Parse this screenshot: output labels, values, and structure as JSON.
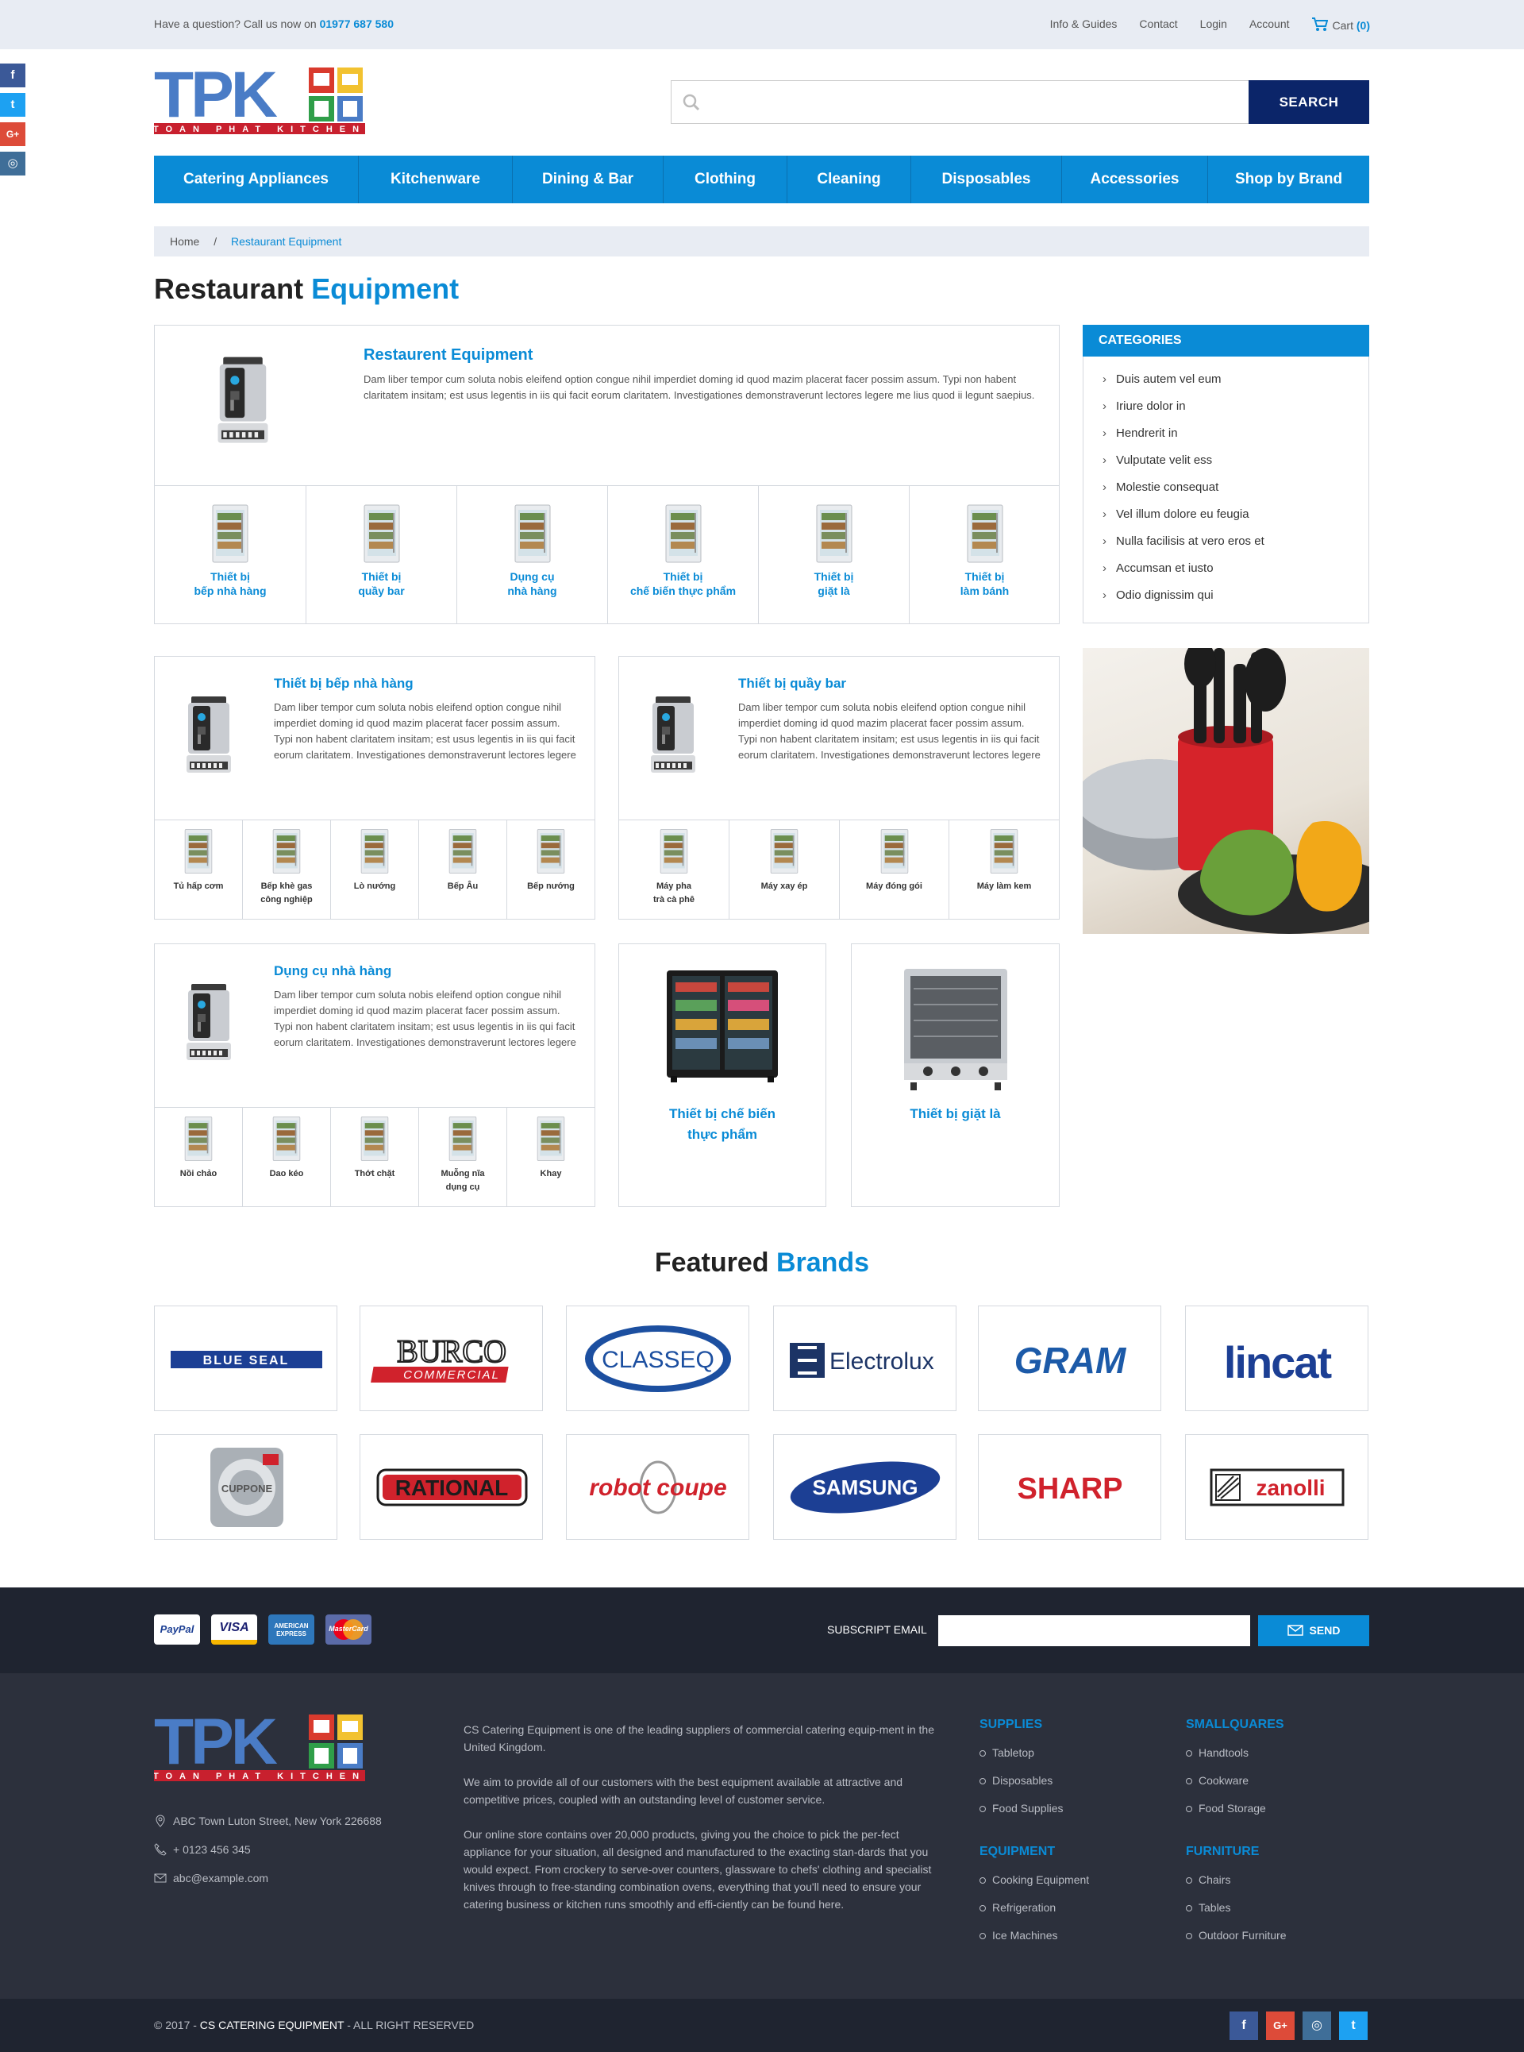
{
  "topbar": {
    "question": "Have a question? Call us now on",
    "phone": "01977 687 580",
    "links": [
      "Info & Guides",
      "Contact",
      "Login",
      "Account"
    ],
    "cart_label": "Cart",
    "cart_count": "(0)"
  },
  "social": [
    {
      "icon": "facebook-icon",
      "glyph": "f",
      "color": "#3b5998"
    },
    {
      "icon": "twitter-icon",
      "glyph": "t",
      "color": "#1da1f2"
    },
    {
      "icon": "google-plus-icon",
      "glyph": "G+",
      "color": "#dd4b39"
    },
    {
      "icon": "instagram-icon",
      "glyph": "◎",
      "color": "#3f6e98"
    }
  ],
  "logo": {
    "text": "TPK",
    "tagline": "TOAN PHAT KITCHEN"
  },
  "search": {
    "button": "SEARCH",
    "placeholder": ""
  },
  "nav": [
    "Catering Appliances",
    "Kitchenware",
    "Dining & Bar",
    "Clothing",
    "Cleaning",
    "Disposables",
    "Accessories",
    "Shop by Brand"
  ],
  "breadcrumb": {
    "home": "Home",
    "sep": "/",
    "current": "Restaurant Equipment"
  },
  "page_title": {
    "a": "Restaurant",
    "b": "Equipment"
  },
  "main": {
    "title": "Restaurent Equipment",
    "desc": "Dam liber tempor cum soluta nobis eleifend option congue nihil imperdiet doming id quod mazim placerat facer possim assum. Typi non habent claritatem insitam; est usus legentis in iis qui facit eorum claritatem. Investigationes demonstraverunt lectores legere me lius quod ii legunt saepius.",
    "subs": [
      "Thiết bị\nbếp nhà hàng",
      "Thiết bị\nquầy bar",
      "Dụng cụ\nnhà hàng",
      "Thiết bị\nchế biến thực phẩm",
      "Thiết bị\ngiặt là",
      "Thiết bị\nlàm bánh"
    ]
  },
  "panel1": {
    "title": "Thiết bị bếp nhà hàng",
    "desc": "Dam liber tempor cum soluta nobis eleifend option congue nihil imperdiet doming id quod mazim placerat facer possim assum. Typi non habent claritatem insitam; est usus legentis in iis qui facit eorum claritatem. Investigationes demonstraverunt lectores legere",
    "subs": [
      "Tủ hấp cơm",
      "Bếp khè gas\ncông nghiệp",
      "Lò nướng",
      "Bếp Âu",
      "Bếp nướng"
    ]
  },
  "panel2": {
    "title": "Thiết bị quầy bar",
    "desc": "Dam liber tempor cum soluta nobis eleifend option congue nihil imperdiet doming id quod mazim placerat facer possim assum. Typi non habent claritatem insitam; est usus legentis in iis qui facit eorum claritatem. Investigationes demonstraverunt lectores legere",
    "subs": [
      "Máy pha\ntrà cà phê",
      "Máy xay ép",
      "Máy đóng gói",
      "Máy làm kem"
    ]
  },
  "panel3": {
    "title": "Dụng cụ nhà hàng",
    "desc": "Dam liber tempor cum soluta nobis eleifend option congue nihil imperdiet doming id quod mazim placerat facer possim assum. Typi non habent claritatem insitam; est usus legentis in iis qui facit eorum claritatem. Investigationes demonstraverunt lectores legere",
    "subs": [
      "Nồi chảo",
      "Dao kéo",
      "Thớt chặt",
      "Muỗng nĩa\ndụng cụ",
      "Khay"
    ]
  },
  "tile1": "Thiết bị chế biến\nthực phẩm",
  "tile2": "Thiết bị giặt là",
  "categories": {
    "title": "CATEGORIES",
    "items": [
      "Duis autem vel eum",
      "Iriure dolor in",
      "Hendrerit in",
      "Vulputate velit ess",
      "Molestie consequat",
      "Vel illum dolore eu feugia",
      "Nulla facilisis at vero eros et",
      "Accumsan et iusto",
      "Odio dignissim qui"
    ]
  },
  "brands_heading": {
    "a": "Featured",
    "b": "Brands"
  },
  "brands": [
    {
      "name": "BLUE SEAL",
      "color": "#1c3f94"
    },
    {
      "name": "BURCO",
      "color": "#222"
    },
    {
      "name": "CLASSEQ",
      "color": "#1c4fa0"
    },
    {
      "name": "Electrolux",
      "color": "#1c3466"
    },
    {
      "name": "GRAM",
      "color": "#1c5aa8"
    },
    {
      "name": "lincat",
      "color": "#1c3f94"
    },
    {
      "name": "CUPPONE",
      "color": "#777"
    },
    {
      "name": "RATIONAL",
      "color": "#d0222c"
    },
    {
      "name": "robot coupe",
      "color": "#d0222c"
    },
    {
      "name": "SAMSUNG",
      "color": "#1c3f94"
    },
    {
      "name": "SHARP",
      "color": "#d0222c"
    },
    {
      "name": "zanolli",
      "color": "#d0222c"
    }
  ],
  "burco_sub": "COMMERCIAL",
  "payments": [
    {
      "label": "PayPal",
      "bg": "#fff",
      "fg": "#1c3f94"
    },
    {
      "label": "VISA",
      "bg": "#fff",
      "fg": "#1a1f71"
    },
    {
      "label": "AMERICAN EXPRESS",
      "bg": "#2e77bb",
      "fg": "#fff"
    },
    {
      "label": "MasterCard",
      "bg": "#5b6ba8",
      "fg": "#fff"
    }
  ],
  "subscribe": {
    "label": "SUBSCRIPT EMAIL",
    "button": "SEND",
    "placeholder": ""
  },
  "footer": {
    "address": "ABC Town Luton Street, New York 226688",
    "phone": "+ 0123 456 345",
    "email": "abc@example.com",
    "about1": "CS Catering Equipment is one of the leading suppliers of commercial catering equip-ment in the United Kingdom.",
    "about2": "We aim to provide all of our customers with the best equipment available at attractive and competitive prices, coupled with an outstanding level of customer service.",
    "about3": "Our online store contains over 20,000 products, giving you the choice to pick the per-fect appliance for your situation, all designed and manufactured to the exacting stan-dards that you would expect. From crockery to serve-over counters, glassware to chefs' clothing and specialist knives through to free-standing combination ovens, everything that you'll need to ensure your catering business or kitchen runs smoothly and effi-ciently can be found here.",
    "cols": [
      {
        "title": "SUPPLIES",
        "items": [
          "Tabletop",
          "Disposables",
          "Food Supplies"
        ]
      },
      {
        "title": "SMALLQUARES",
        "items": [
          "Handtools",
          "Cookware",
          "Food Storage"
        ]
      },
      {
        "title": "EQUIPMENT",
        "items": [
          "Cooking Equipment",
          "Refrigeration",
          "Ice Machines"
        ]
      },
      {
        "title": "FURNITURE",
        "items": [
          "Chairs",
          "Tables",
          "Outdoor Furniture"
        ]
      }
    ],
    "copyright_pre": "© 2017 -",
    "copyright_brand": "CS CATERING EQUIPMENT",
    "copyright_post": "- ALL RIGHT RESERVED"
  },
  "footer_social": [
    {
      "icon": "facebook-icon",
      "glyph": "f",
      "color": "#3b5998"
    },
    {
      "icon": "google-plus-icon",
      "glyph": "G+",
      "color": "#dd4b39"
    },
    {
      "icon": "instagram-icon",
      "glyph": "◎",
      "color": "#3f6e98"
    },
    {
      "icon": "twitter-icon",
      "glyph": "t",
      "color": "#1da1f2"
    }
  ]
}
